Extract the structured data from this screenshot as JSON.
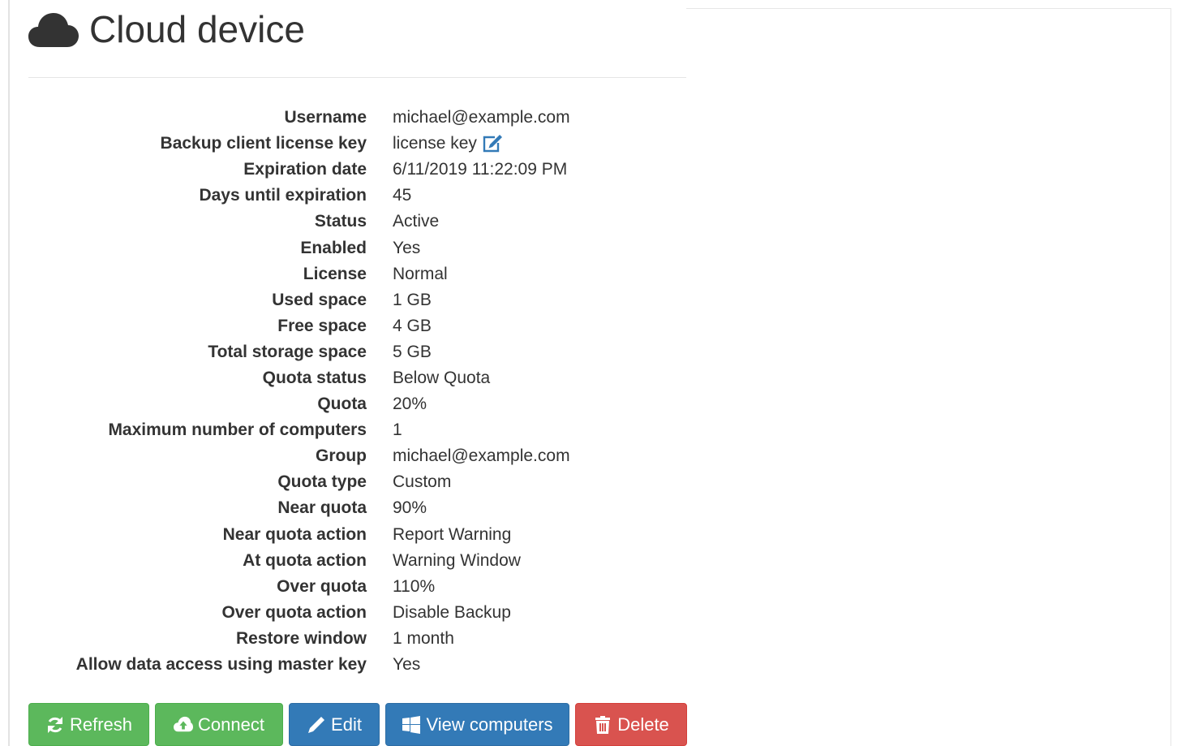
{
  "header": {
    "title": "Cloud device",
    "icon": "cloud-icon"
  },
  "properties": [
    {
      "label": "Username",
      "value": "michael@example.com"
    },
    {
      "label": "Backup client license key",
      "value": "license key",
      "icon": "edit-icon"
    },
    {
      "label": "Expiration date",
      "value": "6/11/2019 11:22:09 PM"
    },
    {
      "label": "Days until expiration",
      "value": "45"
    },
    {
      "label": "Status",
      "value": "Active"
    },
    {
      "label": "Enabled",
      "value": "Yes"
    },
    {
      "label": "License",
      "value": "Normal"
    },
    {
      "label": "Used space",
      "value": "1 GB"
    },
    {
      "label": "Free space",
      "value": "4 GB"
    },
    {
      "label": "Total storage space",
      "value": "5 GB"
    },
    {
      "label": "Quota status",
      "value": "Below Quota"
    },
    {
      "label": "Quota",
      "value": "20%"
    },
    {
      "label": "Maximum number of computers",
      "value": "1"
    },
    {
      "label": "Group",
      "value": "michael@example.com"
    },
    {
      "label": "Quota type",
      "value": "Custom"
    },
    {
      "label": "Near quota",
      "value": "90%"
    },
    {
      "label": "Near quota action",
      "value": "Report Warning"
    },
    {
      "label": "At quota action",
      "value": "Warning Window"
    },
    {
      "label": "Over quota",
      "value": "110%"
    },
    {
      "label": "Over quota action",
      "value": "Disable Backup"
    },
    {
      "label": "Restore window",
      "value": "1 month"
    },
    {
      "label": "Allow data access using master key",
      "value": "Yes"
    }
  ],
  "actions": {
    "refresh": {
      "label": "Refresh",
      "icon": "refresh-icon",
      "color": "#5cb85c"
    },
    "connect": {
      "label": "Connect",
      "icon": "cloud-upload-icon",
      "color": "#5cb85c"
    },
    "edit": {
      "label": "Edit",
      "icon": "pencil-icon",
      "color": "#337ab7"
    },
    "view_computers": {
      "label": "View computers",
      "icon": "windows-icon",
      "color": "#337ab7"
    },
    "delete": {
      "label": "Delete",
      "icon": "trash-icon",
      "color": "#d9534f"
    }
  },
  "colors": {
    "success": "#5cb85c",
    "primary": "#337ab7",
    "danger": "#d9534f",
    "link": "#337ab7"
  }
}
